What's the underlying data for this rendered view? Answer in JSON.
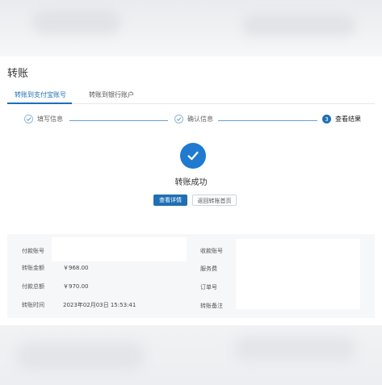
{
  "page": {
    "title": "转账"
  },
  "tabs": [
    {
      "label": "转账到支付宝账号",
      "active": true
    },
    {
      "label": "转账到银行账户",
      "active": false
    }
  ],
  "steps": [
    {
      "label": "填写信息",
      "state": "done"
    },
    {
      "label": "确认信息",
      "state": "done"
    },
    {
      "label": "查看结果",
      "state": "current",
      "number": "3"
    }
  ],
  "result": {
    "message": "转账成功",
    "primary_button": "查看详情",
    "secondary_button": "返回转账首页"
  },
  "details": {
    "left": [
      {
        "label": "付款账号",
        "value": ""
      },
      {
        "label": "转账金额",
        "value": "￥968.00"
      },
      {
        "label": "付款总额",
        "value": "￥970.00"
      },
      {
        "label": "转账时间",
        "value": "2023年02月03日 15:53:41"
      }
    ],
    "right": [
      {
        "label": "收款账号",
        "value": ""
      },
      {
        "label": "服务费",
        "value": ""
      },
      {
        "label": "订单号",
        "value": ""
      },
      {
        "label": "转账备注",
        "value": ""
      }
    ]
  },
  "colors": {
    "accent": "#1f6fb4",
    "success": "#1f7ad0"
  }
}
